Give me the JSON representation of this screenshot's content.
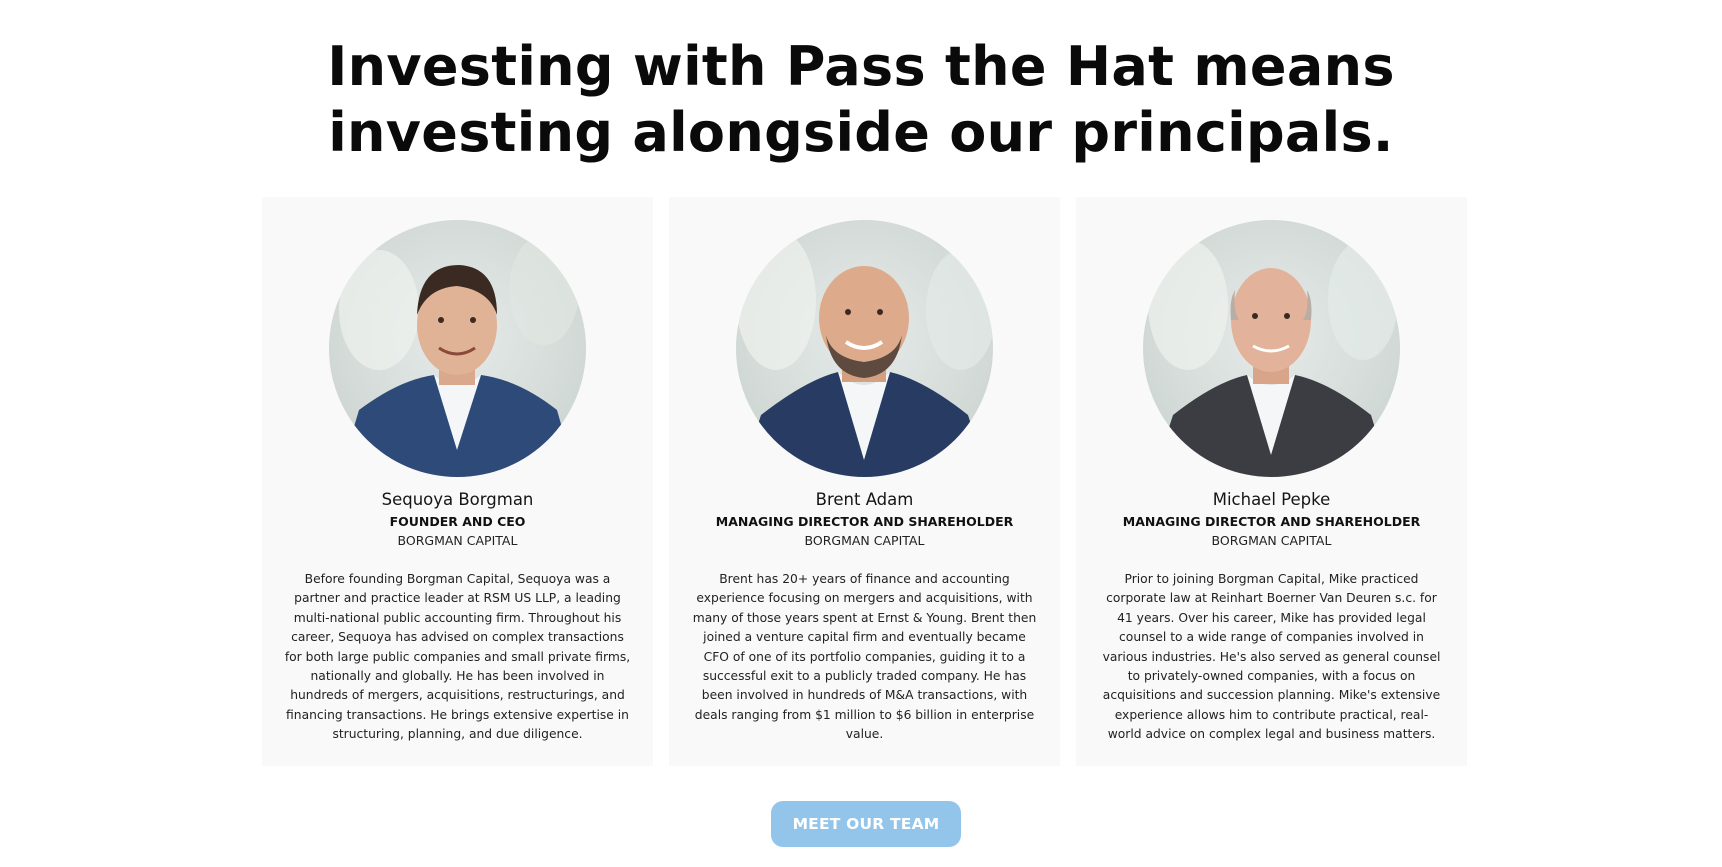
{
  "headline": {
    "line1": "Investing with Pass the Hat means",
    "line2": "investing alongside our principals."
  },
  "principals": [
    {
      "name": "Sequoya Borgman",
      "role": "FOUNDER AND CEO",
      "company": "BORGMAN CAPITAL",
      "bio": "Before founding Borgman Capital, Sequoya was a partner and practice leader at RSM US LLP, a leading multi-national public accounting firm. Throughout his career, Sequoya has advised on complex transactions for both large public companies and small private firms, nationally and globally. He has been involved in hundreds of mergers, acquisitions, restructurings, and financing transactions. He brings extensive expertise in structuring, planning, and due diligence.",
      "photo_icon": "portrait-photo"
    },
    {
      "name": "Brent Adam",
      "role": "MANAGING DIRECTOR AND SHAREHOLDER",
      "company": "BORGMAN CAPITAL",
      "bio": "Brent has 20+ years of finance and accounting experience focusing on mergers and acquisitions, with many of those years spent at Ernst & Young. Brent then joined a venture capital firm and eventually became CFO of one of its portfolio companies, guiding it to a successful exit to a publicly traded company. He has been involved in hundreds of M&A transactions, with deals ranging from $1 million to $6 billion in enterprise value.",
      "photo_icon": "portrait-photo"
    },
    {
      "name": "Michael Pepke",
      "role": "MANAGING DIRECTOR AND SHAREHOLDER",
      "company": "BORGMAN CAPITAL",
      "bio": "Prior to joining Borgman Capital, Mike practiced corporate law at Reinhart Boerner Van Deuren s.c. for 41 years. Over his career, Mike has provided legal counsel to a wide range of companies involved in various industries. He's also served as general counsel to privately-owned companies, with a focus on acquisitions and succession planning. Mike's extensive experience allows him to contribute practical, real-world advice on complex legal and business matters.",
      "photo_icon": "portrait-photo"
    }
  ],
  "cta": {
    "label": "MEET OUR TEAM"
  },
  "colors": {
    "card_background": "#f9f9f9",
    "button_background": "#93c5ea",
    "button_text": "#ffffff",
    "headline": "#0a0a0a"
  }
}
